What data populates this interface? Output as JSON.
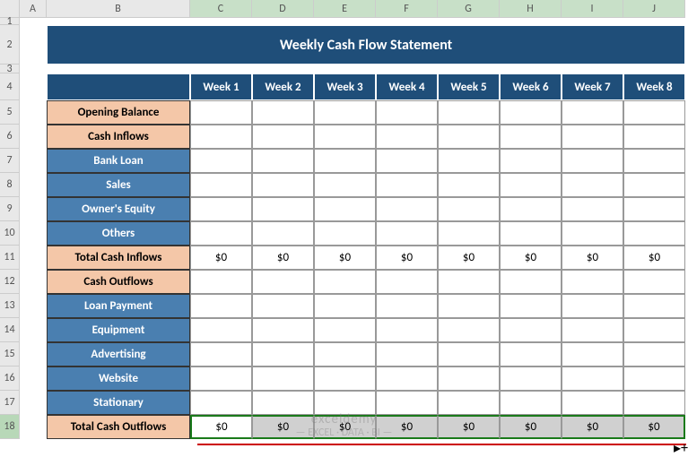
{
  "columns": [
    "A",
    "B",
    "C",
    "D",
    "E",
    "F",
    "G",
    "H",
    "I",
    "J"
  ],
  "rows": [
    "1",
    "2",
    "3",
    "4",
    "5",
    "6",
    "7",
    "8",
    "9",
    "10",
    "11",
    "12",
    "13",
    "14",
    "15",
    "16",
    "17",
    "18"
  ],
  "title": "Weekly Cash Flow Statement",
  "weeks": [
    "Week 1",
    "Week 2",
    "Week 3",
    "Week 4",
    "Week 5",
    "Week 6",
    "Week 7",
    "Week 8"
  ],
  "labels": {
    "opening": "Opening Balance",
    "inflows_h": "Cash Inflows",
    "bank": "Bank Loan",
    "sales": "Sales",
    "equity": "Owner's Equity",
    "others": "Others",
    "total_in": "Total Cash Inflows",
    "outflows_h": "Cash Outflows",
    "loan_pay": "Loan Payment",
    "equipment": "Equipment",
    "advertising": "Advertising",
    "website": "Website",
    "stationary": "Stationary",
    "total_out": "Total Cash Outflows"
  },
  "zero": "$0",
  "watermark": {
    "brand": "exceldemy",
    "tag": "— EXCEL · DATA · BI —"
  },
  "chart_data": {
    "type": "table",
    "title": "Weekly Cash Flow Statement",
    "columns": [
      "Week 1",
      "Week 2",
      "Week 3",
      "Week 4",
      "Week 5",
      "Week 6",
      "Week 7",
      "Week 8"
    ],
    "rows": [
      {
        "name": "Opening Balance",
        "values": [
          null,
          null,
          null,
          null,
          null,
          null,
          null,
          null
        ]
      },
      {
        "name": "Bank Loan",
        "values": [
          null,
          null,
          null,
          null,
          null,
          null,
          null,
          null
        ]
      },
      {
        "name": "Sales",
        "values": [
          null,
          null,
          null,
          null,
          null,
          null,
          null,
          null
        ]
      },
      {
        "name": "Owner's Equity",
        "values": [
          null,
          null,
          null,
          null,
          null,
          null,
          null,
          null
        ]
      },
      {
        "name": "Others",
        "values": [
          null,
          null,
          null,
          null,
          null,
          null,
          null,
          null
        ]
      },
      {
        "name": "Total Cash Inflows",
        "values": [
          0,
          0,
          0,
          0,
          0,
          0,
          0,
          0
        ]
      },
      {
        "name": "Loan Payment",
        "values": [
          null,
          null,
          null,
          null,
          null,
          null,
          null,
          null
        ]
      },
      {
        "name": "Equipment",
        "values": [
          null,
          null,
          null,
          null,
          null,
          null,
          null,
          null
        ]
      },
      {
        "name": "Advertising",
        "values": [
          null,
          null,
          null,
          null,
          null,
          null,
          null,
          null
        ]
      },
      {
        "name": "Website",
        "values": [
          null,
          null,
          null,
          null,
          null,
          null,
          null,
          null
        ]
      },
      {
        "name": "Stationary",
        "values": [
          null,
          null,
          null,
          null,
          null,
          null,
          null,
          null
        ]
      },
      {
        "name": "Total Cash Outflows",
        "values": [
          0,
          0,
          0,
          0,
          0,
          0,
          0,
          0
        ]
      }
    ]
  }
}
